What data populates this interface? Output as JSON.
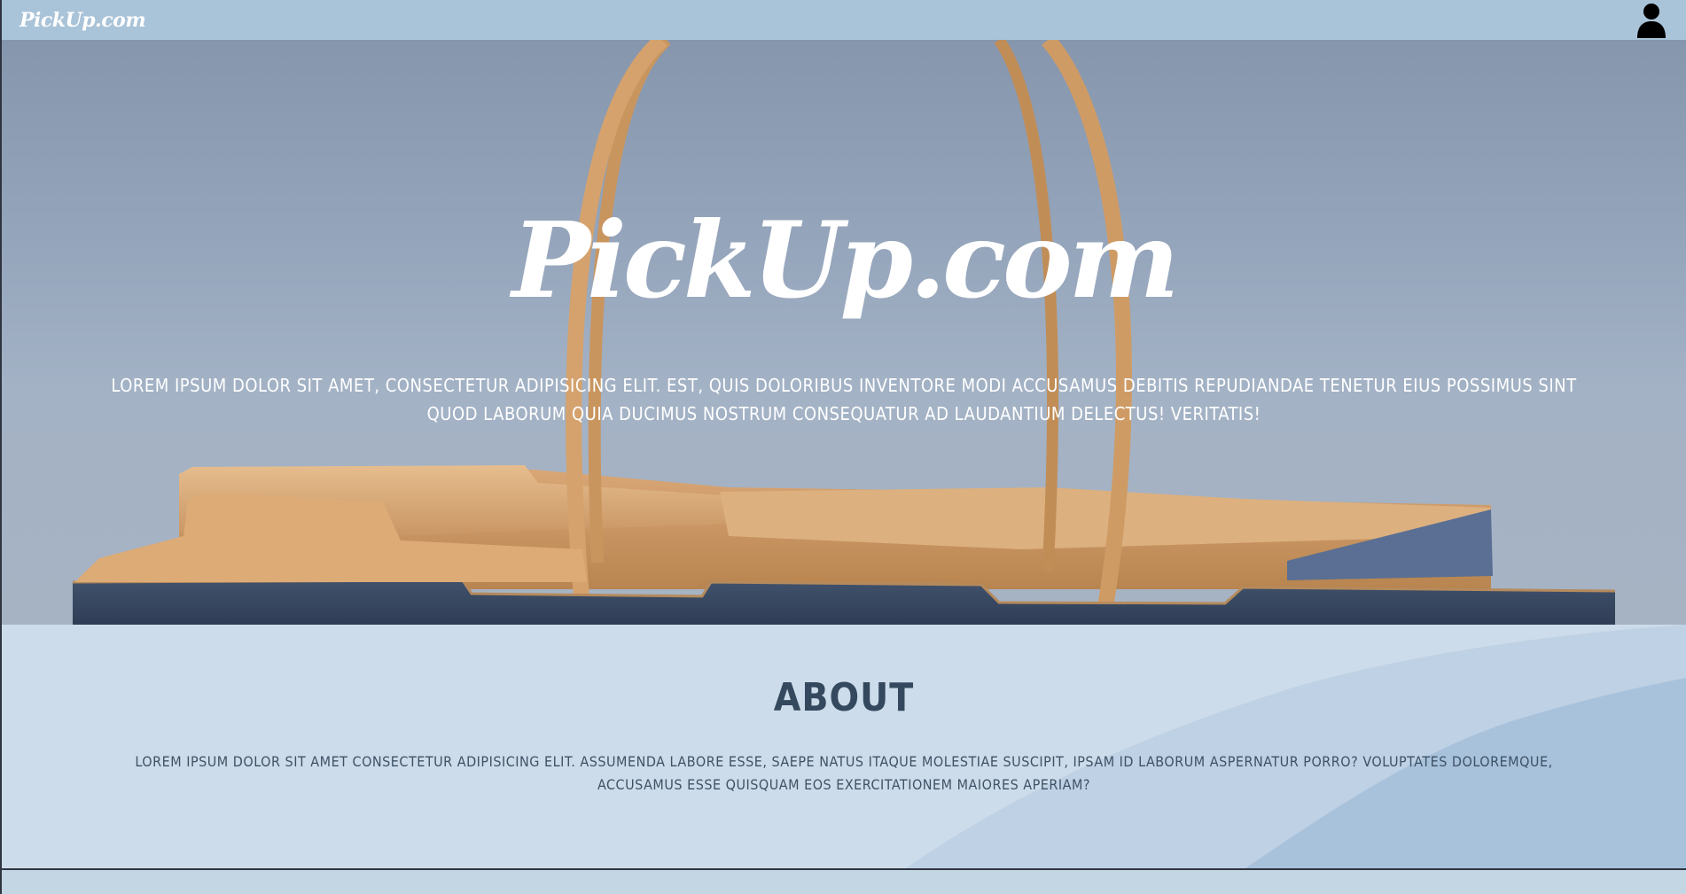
{
  "nav": {
    "logo": "PickUp.com",
    "user_icon": "user-icon"
  },
  "hero": {
    "title": "PickUp.com",
    "text": "Lorem ipsum dolor sit amet, consectetur adipisicing elit. Est, quis doloribus inventore modi accusamus debitis repudiandae tenetur eius possimus sint quod laborum quia ducimus nostrum consequatur ad laudantium delectus! Veritatis!"
  },
  "about": {
    "title": "ABOUT",
    "text": "Lorem ipsum dolor sit amet consectetur adipisicing elit. Assumenda labore esse, saepe natus itaque molestiae suscipit, ipsam id laborum aspernatur porro? Voluptates doloremque, accusamus esse quisquam eos exercitationem maiores aperiam?"
  },
  "colors": {
    "navbar": "#a9c3d8",
    "about_bg": "#cddcea",
    "about_title": "#34495e"
  }
}
